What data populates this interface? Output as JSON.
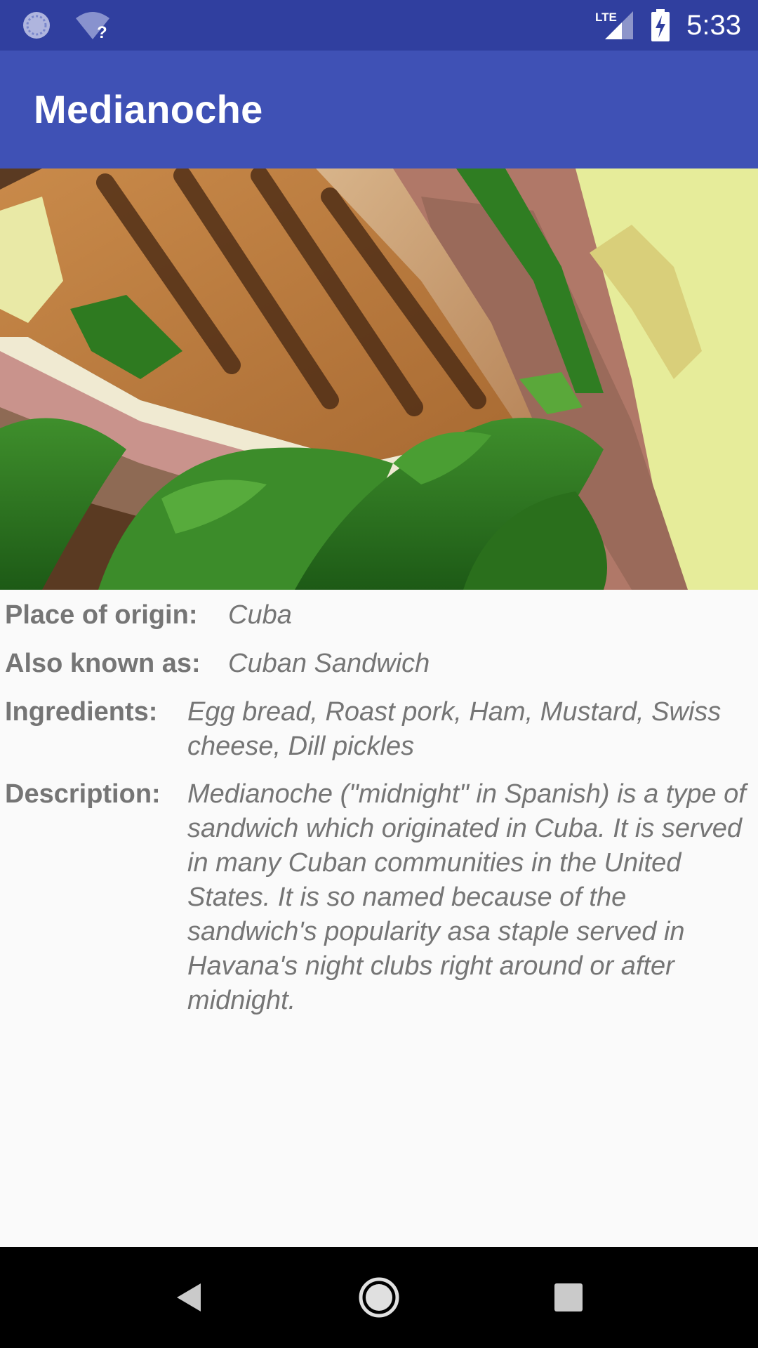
{
  "status_bar": {
    "time": "5:33",
    "network_label": "LTE",
    "icons": [
      "sync-icon",
      "wifi-unknown-icon",
      "lte-signal-icon",
      "battery-charging-icon"
    ]
  },
  "app_bar": {
    "title": "Medianoche"
  },
  "hero_image": {
    "subject": "sandwich-photo"
  },
  "details": {
    "origin": {
      "label": "Place of origin:",
      "value": "Cuba"
    },
    "aka": {
      "label": "Also known as:",
      "value": "Cuban Sandwich"
    },
    "ingredients": {
      "label": "Ingredients:",
      "value": "Egg bread, Roast pork, Ham, Mustard, Swiss cheese, Dill pickles"
    },
    "description": {
      "label": "Description:",
      "value": "Medianoche (\"midnight\" in Spanish) is a type of sandwich which originated in Cuba. It is served in many Cuban communities in the United States. It is so named because of the sandwich's popularity asa staple served in Havana's night clubs right around or after midnight."
    }
  },
  "nav_bar": {
    "buttons": [
      "back-icon",
      "home-icon",
      "recents-icon"
    ]
  },
  "colors": {
    "status_bar": "#303f9f",
    "app_bar": "#3f51b5",
    "background": "#fafafa",
    "text": "#757575",
    "nav_bar": "#000000"
  }
}
